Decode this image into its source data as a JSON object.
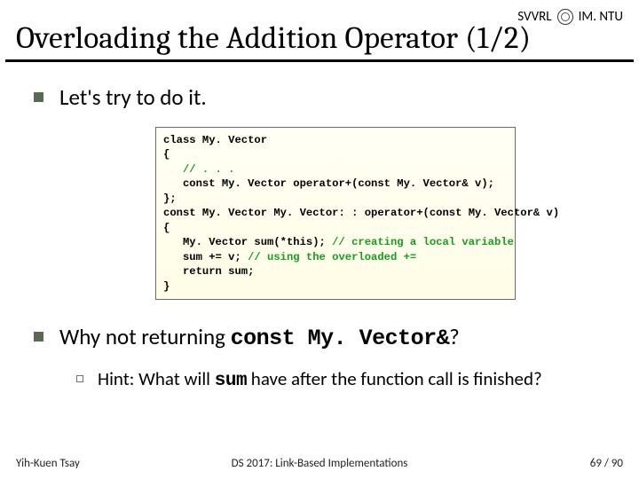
{
  "header": {
    "org_left": "SVVRL",
    "org_right": "IM. NTU"
  },
  "title": "Overloading the Addition Operator (1/2)",
  "bullets": {
    "b1": "Let's try to do it.",
    "b2_pre": "Why not returning ",
    "b2_code": "const My. Vector&",
    "b2_post": "?"
  },
  "sub": {
    "s1_pre": "Hint: What will ",
    "s1_code": "sum",
    "s1_post": " have after the function call is finished?"
  },
  "code": {
    "l1": "class My. Vector",
    "l2": "{",
    "l3_indent": "   ",
    "l3_comment": "// . . .",
    "l4": "   const My. Vector operator+(const My. Vector& v);",
    "l5": "};",
    "l6": "const My. Vector My. Vector: : operator+(const My. Vector& v)",
    "l7": "{",
    "l8a": "   My. Vector sum(*this); ",
    "l8b": "// creating a local variable",
    "l9a": "   sum += v; ",
    "l9b": "// using the overloaded +=",
    "l10": "   return sum;",
    "l11": "}"
  },
  "footer": {
    "left": "Yih-Kuen Tsay",
    "center": "DS 2017: Link-Based Implementations",
    "right": "69 / 90"
  }
}
